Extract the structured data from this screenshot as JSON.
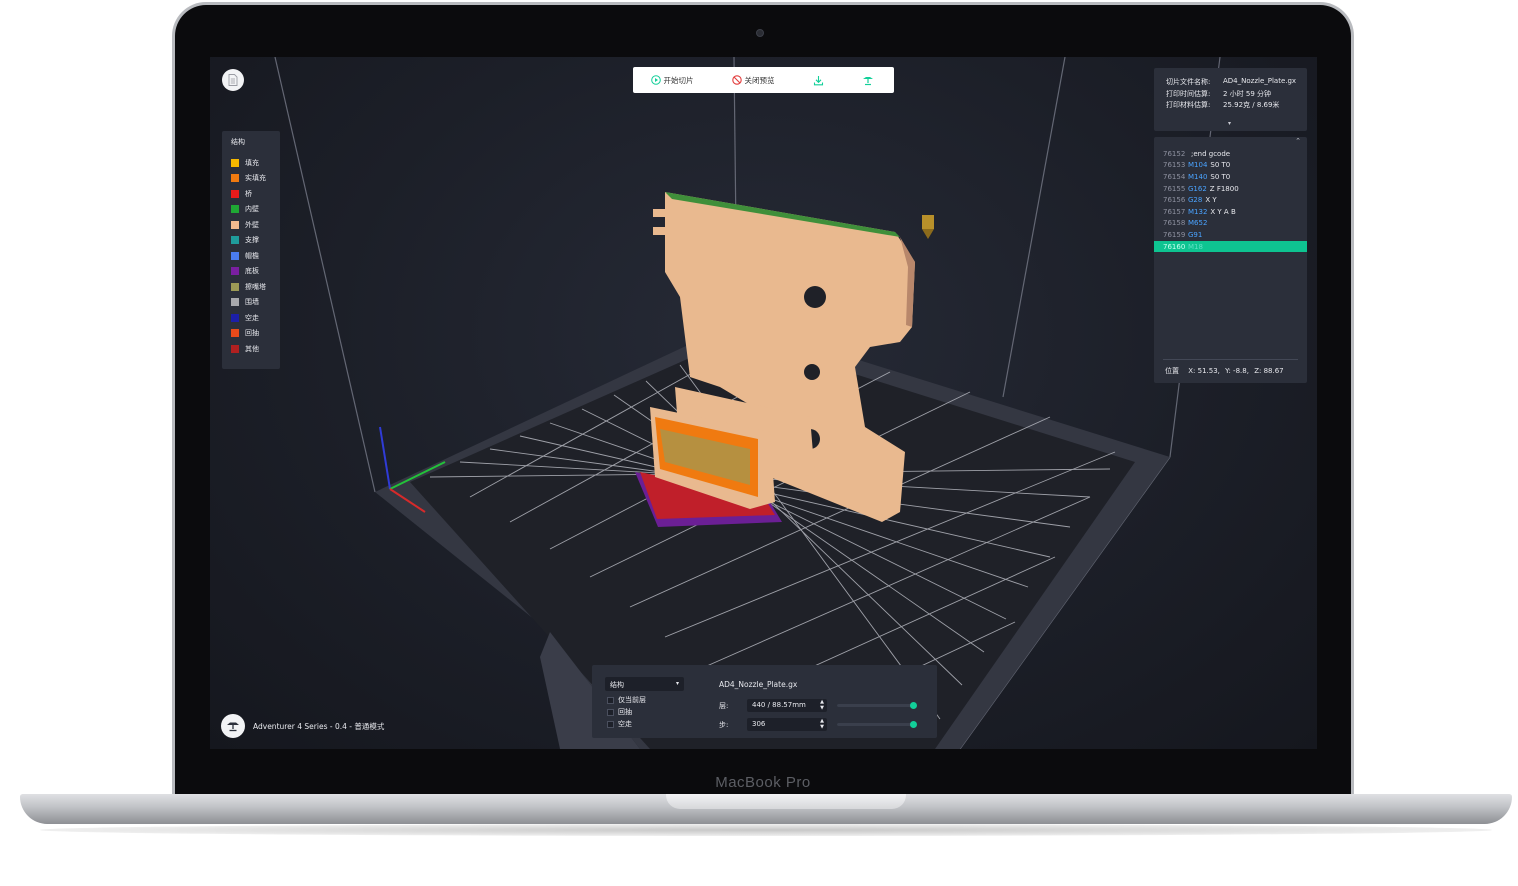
{
  "device": {
    "label": "MacBook Pro"
  },
  "toolbar": {
    "start_slice": "开始切片",
    "close_preview": "关闭预览"
  },
  "legend": {
    "title": "结构",
    "items": [
      {
        "label": "填充",
        "color": "#f5b800"
      },
      {
        "label": "实填充",
        "color": "#f07a10"
      },
      {
        "label": "桥",
        "color": "#e81b1b"
      },
      {
        "label": "内壁",
        "color": "#1fa834"
      },
      {
        "label": "外壁",
        "color": "#f2b98e"
      },
      {
        "label": "支撑",
        "color": "#1f9c9c"
      },
      {
        "label": "帽檐",
        "color": "#4a7cf0"
      },
      {
        "label": "底板",
        "color": "#7a1fa0"
      },
      {
        "label": "擦嘴塔",
        "color": "#9c9a56"
      },
      {
        "label": "围墙",
        "color": "#a8a9ad"
      },
      {
        "label": "空走",
        "color": "#1c1fa8"
      },
      {
        "label": "回抽",
        "color": "#e84a1a"
      },
      {
        "label": "其他",
        "color": "#b02020"
      }
    ]
  },
  "info": {
    "rows": [
      {
        "key": "切片文件名称:",
        "value": "AD4_Nozzle_Plate.gx"
      },
      {
        "key": "打印时间估算:",
        "value": "2 小时 59 分钟"
      },
      {
        "key": "打印材料估算:",
        "value": "25.92克 / 8.69米"
      }
    ]
  },
  "gcode": {
    "lines": [
      {
        "num": "76152",
        "cmd": "",
        "args": ";end gcode",
        "active": false
      },
      {
        "num": "76153",
        "cmd": "M104",
        "args": "S0 T0",
        "active": false
      },
      {
        "num": "76154",
        "cmd": "M140",
        "args": "S0 T0",
        "active": false
      },
      {
        "num": "76155",
        "cmd": "G162",
        "args": "Z F1800",
        "active": false
      },
      {
        "num": "76156",
        "cmd": "G28",
        "args": "X Y",
        "active": false
      },
      {
        "num": "76157",
        "cmd": "M132",
        "args": "X Y A B",
        "active": false
      },
      {
        "num": "76158",
        "cmd": "M652",
        "args": "",
        "active": false
      },
      {
        "num": "76159",
        "cmd": "G91",
        "args": "",
        "active": false
      },
      {
        "num": "76160",
        "cmd": "M18",
        "args": "",
        "active": true
      }
    ],
    "position": {
      "label": "位置",
      "x": "X: 51.53,",
      "y": "Y: -8.8,",
      "z": "Z: 88.67"
    }
  },
  "bottom_panel": {
    "select_value": "结构",
    "checkboxes": [
      {
        "label": "仅当前层",
        "checked": false
      },
      {
        "label": "回抽",
        "checked": false
      },
      {
        "label": "空走",
        "checked": false
      }
    ],
    "filename": "AD4_Nozzle_Plate.gx",
    "layer_label": "层:",
    "layer_value": "440 / 88.57mm",
    "layer_level": 1.0,
    "step_label": "步:",
    "step_value": "306",
    "step_level": 1.0
  },
  "printer": {
    "label": "Adventurer 4 Series - 0.4 - 普通模式"
  },
  "colors": {
    "accent": "#12cf99",
    "panel": "#2b2f3a",
    "gcode_cmd": "#4aa3ff"
  }
}
